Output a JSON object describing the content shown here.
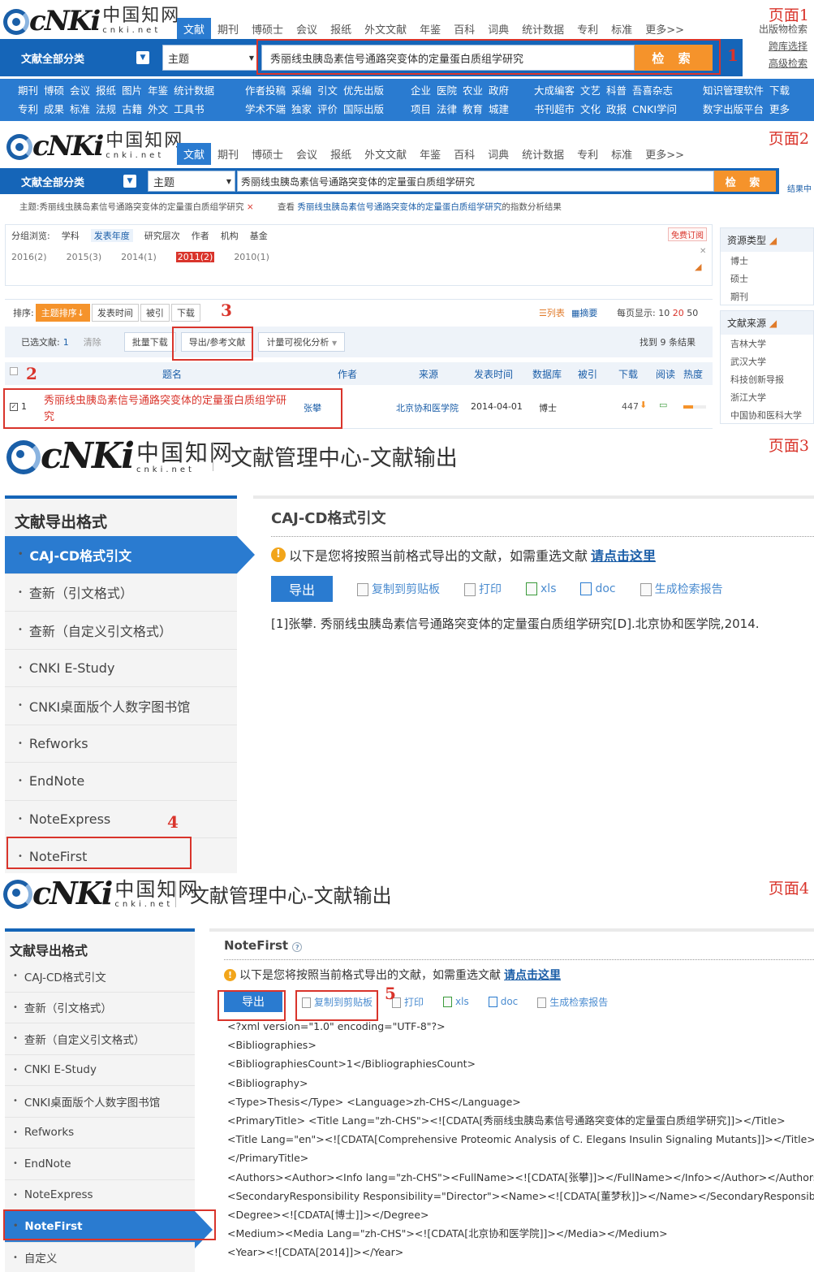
{
  "panel1": {
    "page_tag": "页面1",
    "logo_word": "cNKi",
    "logo_cn": "中国知网",
    "logo_url": "cnki.net",
    "tabs": [
      "文献",
      "期刊",
      "博硕士",
      "会议",
      "报纸",
      "外文文献",
      "年鉴",
      "百科",
      "词典",
      "统计数据",
      "专利",
      "标准",
      "更多>>"
    ],
    "category_label": "文献全部分类",
    "field_label": "主题",
    "search_value": "秀丽线虫胰岛素信号通路突变体的定量蛋白质组学研究",
    "search_button": "检 索",
    "right_links": [
      "出版物检索",
      "跨库选择",
      "高级检索"
    ],
    "nav_groups": [
      {
        "row1": [
          "期刊",
          "博硕",
          "会议",
          "报纸",
          "图片",
          "年鉴",
          "统计数据"
        ],
        "row2": [
          "专利",
          "成果",
          "标准",
          "法规",
          "古籍",
          "外文",
          "工具书"
        ]
      },
      {
        "row1": [
          "作者投稿",
          "采编",
          "引文",
          "优先出版"
        ],
        "row2": [
          "学术不端",
          "独家",
          "评价",
          "国际出版"
        ]
      },
      {
        "row1": [
          "企业",
          "医院",
          "农业",
          "政府"
        ],
        "row2": [
          "项目",
          "法律",
          "教育",
          "城建"
        ]
      },
      {
        "row1": [
          "大成编客",
          "文艺",
          "科普",
          "吾喜杂志"
        ],
        "row2": [
          "书刊超市",
          "文化",
          "政报",
          "CNKI学问"
        ]
      },
      {
        "row1": [
          "知识管理软件",
          "下载"
        ],
        "row2": [
          "数字出版平台",
          "更多"
        ]
      }
    ],
    "step_number": "1"
  },
  "panel2": {
    "page_tag": "页面2",
    "tabs": [
      "文献",
      "期刊",
      "博硕士",
      "会议",
      "报纸",
      "外文文献",
      "年鉴",
      "百科",
      "词典",
      "统计数据",
      "专利",
      "标准",
      "更多>>"
    ],
    "category_label": "文献全部分类",
    "field_label": "主题",
    "search_value": "秀丽线虫胰岛素信号通路突变体的定量蛋白质组学研究",
    "search_button": "检 索",
    "result_in": "结果中",
    "crumb_prefix": "主题:秀丽线虫胰岛素信号通路突变体的定量蛋白质组学研究",
    "crumb_close": "×",
    "crumb_view": "查看",
    "crumb_link": "秀丽线虫胰岛素信号通路突变体的定量蛋白质组学研究",
    "crumb_suffix": "的指数分析结果",
    "group_label": "分组浏览:",
    "group_items": [
      "学科",
      "发表年度",
      "研究层次",
      "作者",
      "机构",
      "基金"
    ],
    "subscribe": "免费订阅",
    "years": [
      "2016(2)",
      "2015(3)",
      "2014(1)",
      "2011(2)",
      "2010(1)"
    ],
    "sort_label": "排序:",
    "sort_buttons": [
      "主题排序↓",
      "发表时间",
      "被引",
      "下载"
    ],
    "view_list": "列表",
    "view_abstract": "摘要",
    "per_page_label": "每页显示:",
    "per_page_options": [
      "10",
      "20",
      "50"
    ],
    "selected_label": "已选文献:",
    "selected_count": "1",
    "clear": "清除",
    "batch_download": "批量下载",
    "export_refs": "导出/参考文献",
    "visual_analysis": "计量可视化分析",
    "found": "找到 9 条结果",
    "columns": [
      "题名",
      "作者",
      "来源",
      "发表时间",
      "数据库",
      "被引",
      "下载",
      "阅读",
      "热度"
    ],
    "row": {
      "index": "1",
      "title": "秀丽线虫胰岛素信号通路突变体的定量蛋白质组学研究",
      "author": "张攀",
      "source": "北京协和医学院",
      "date": "2014-04-01",
      "database": "博士",
      "downloads": "447"
    },
    "side_resource_title": "资源类型",
    "side_resource_items": [
      "博士",
      "硕士",
      "期刊"
    ],
    "side_source_title": "文献来源",
    "side_source_items": [
      "吉林大学",
      "武汉大学",
      "科技创新导报",
      "浙江大学",
      "中国协和医科大学"
    ],
    "step_numbers": [
      "2",
      "3"
    ]
  },
  "panel3": {
    "page_tag": "页面3",
    "title": "文献管理中心-文献输出",
    "side_heading": "文献导出格式",
    "side_items": [
      "CAJ-CD格式引文",
      "查新（引文格式）",
      "查新（自定义引文格式）",
      "CNKI E-Study",
      "CNKI桌面版个人数字图书馆",
      "Refworks",
      "EndNote",
      "NoteExpress",
      "NoteFirst"
    ],
    "main_heading": "CAJ-CD格式引文",
    "notice": "以下是您将按照当前格式导出的文献，如需重选文献",
    "notice_link": "请点击这里",
    "export_button": "导出",
    "actions": [
      "复制到剪贴板",
      "打印",
      "xls",
      "doc",
      "生成检索报告"
    ],
    "citation": "[1]张攀. 秀丽线虫胰岛素信号通路突变体的定量蛋白质组学研究[D].北京协和医学院,2014.",
    "step_number": "4"
  },
  "panel4": {
    "page_tag": "页面4",
    "title": "文献管理中心-文献输出",
    "side_heading": "文献导出格式",
    "side_items": [
      "CAJ-CD格式引文",
      "查新（引文格式）",
      "查新（自定义引文格式）",
      "CNKI E-Study",
      "CNKI桌面版个人数字图书馆",
      "Refworks",
      "EndNote",
      "NoteExpress",
      "NoteFirst",
      "自定义"
    ],
    "main_heading": "NoteFirst",
    "notice": "以下是您将按照当前格式导出的文献，如需重选文献",
    "notice_link": "请点击这里",
    "export_button": "导出",
    "actions": [
      "复制到剪贴板",
      "打印",
      "xls",
      "doc",
      "生成检索报告"
    ],
    "xml_lines": [
      "<?xml version=\"1.0\" encoding=\"UTF-8\"?>",
      "<Bibliographies>",
      "<BibliographiesCount>1</BibliographiesCount>",
      "<Bibliography>",
      "<Type>Thesis</Type> <Language>zh-CHS</Language>",
      "<PrimaryTitle> <Title Lang=\"zh-CHS\"><![CDATA[秀丽线虫胰岛素信号通路突变体的定量蛋白质组学研究]]></Title>",
      "<Title Lang=\"en\"><![CDATA[Comprehensive Proteomic Analysis of C. Elegans Insulin Signaling Mutants]]></Title>",
      "</PrimaryTitle>",
      "<Authors><Author><Info lang=\"zh-CHS\"><FullName><![CDATA[张攀]]></FullName></Info></Author></Authors>",
      "<SecondaryResponsibility Responsibility=\"Director\"><Name><![CDATA[董梦秋]]></Name></SecondaryResponsibility>",
      "<Degree><![CDATA[博士]]></Degree>",
      "<Medium><Media Lang=\"zh-CHS\"><![CDATA[北京协和医学院]]></Media></Medium>",
      "<Year><![CDATA[2014]]></Year>"
    ],
    "step_number": "5"
  },
  "colors": {
    "brand_blue": "#1565b8",
    "accent_orange": "#f5932b",
    "annotation_red": "#d9342b"
  }
}
